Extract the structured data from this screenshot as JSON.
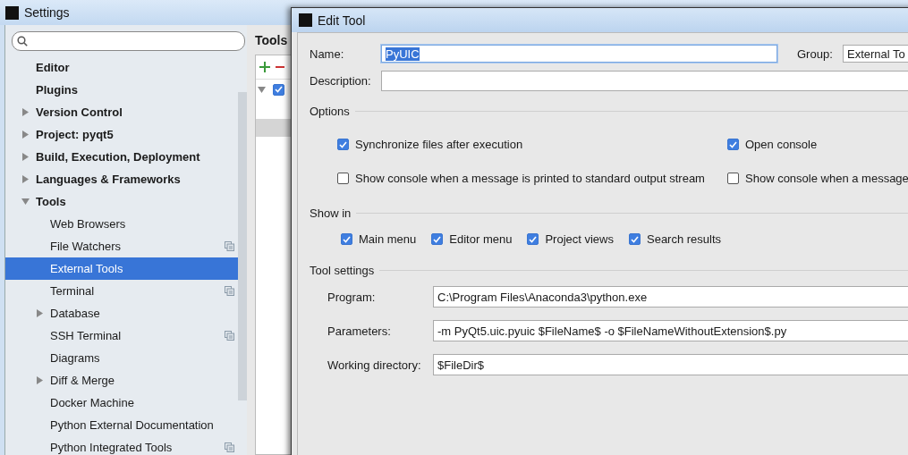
{
  "settings_window": {
    "title": "Settings"
  },
  "sidebar": {
    "items": [
      {
        "label": "Editor",
        "selected": false
      },
      {
        "label": "Plugins",
        "selected": false
      },
      {
        "label": "Version Control",
        "expanded": false,
        "selected": false
      },
      {
        "label": "Project: pyqt5",
        "expanded": false,
        "selected": false
      },
      {
        "label": "Build, Execution, Deployment",
        "expanded": false,
        "selected": false
      },
      {
        "label": "Languages & Frameworks",
        "expanded": false,
        "selected": false
      },
      {
        "label": "Tools",
        "expanded": true,
        "selected": false,
        "children": [
          {
            "label": "Web Browsers",
            "selected": false,
            "project_level": false
          },
          {
            "label": "File Watchers",
            "selected": false,
            "project_level": true
          },
          {
            "label": "External Tools",
            "selected": true,
            "project_level": false
          },
          {
            "label": "Terminal",
            "selected": false,
            "project_level": true
          },
          {
            "label": "Database",
            "expanded": false,
            "selected": false,
            "project_level": false
          },
          {
            "label": "SSH Terminal",
            "selected": false,
            "project_level": true
          },
          {
            "label": "Diagrams",
            "selected": false,
            "project_level": false
          },
          {
            "label": "Diff & Merge",
            "expanded": false,
            "selected": false,
            "project_level": false
          },
          {
            "label": "Docker Machine",
            "selected": false,
            "project_level": false
          },
          {
            "label": "Python External Documentation",
            "selected": false,
            "project_level": false
          },
          {
            "label": "Python Integrated Tools",
            "selected": false,
            "project_level": true
          }
        ]
      }
    ]
  },
  "tools_panel": {
    "title": "Tools",
    "tree_row": {
      "expanded": true,
      "checked": true
    }
  },
  "dialog": {
    "title": "Edit Tool",
    "name": {
      "label": "Name:",
      "value": "PyUIC"
    },
    "group": {
      "label": "Group:",
      "value": "External To"
    },
    "description": {
      "label": "Description:"
    },
    "options": {
      "title": "Options",
      "checkboxes": [
        {
          "label": "Synchronize files after execution",
          "checked": true
        },
        {
          "label": "Open console",
          "checked": true
        },
        {
          "label": "Show console when a message is printed to standard output stream",
          "checked": false
        },
        {
          "label": "Show console when a message",
          "checked": false
        }
      ]
    },
    "show_in": {
      "title": "Show in",
      "checkboxes": [
        {
          "label": "Main menu",
          "checked": true
        },
        {
          "label": "Editor menu",
          "checked": true
        },
        {
          "label": "Project views",
          "checked": true
        },
        {
          "label": "Search results",
          "checked": true
        }
      ]
    },
    "tool_settings": {
      "title": "Tool settings",
      "fields": [
        {
          "label": "Program:",
          "value": "C:\\Program Files\\Anaconda3\\python.exe"
        },
        {
          "label": "Parameters:",
          "value": "-m PyQt5.uic.pyuic $FileName$ -o $FileNameWithoutExtension$.py"
        },
        {
          "label": "Working directory:",
          "value": "$FileDir$"
        }
      ]
    }
  }
}
